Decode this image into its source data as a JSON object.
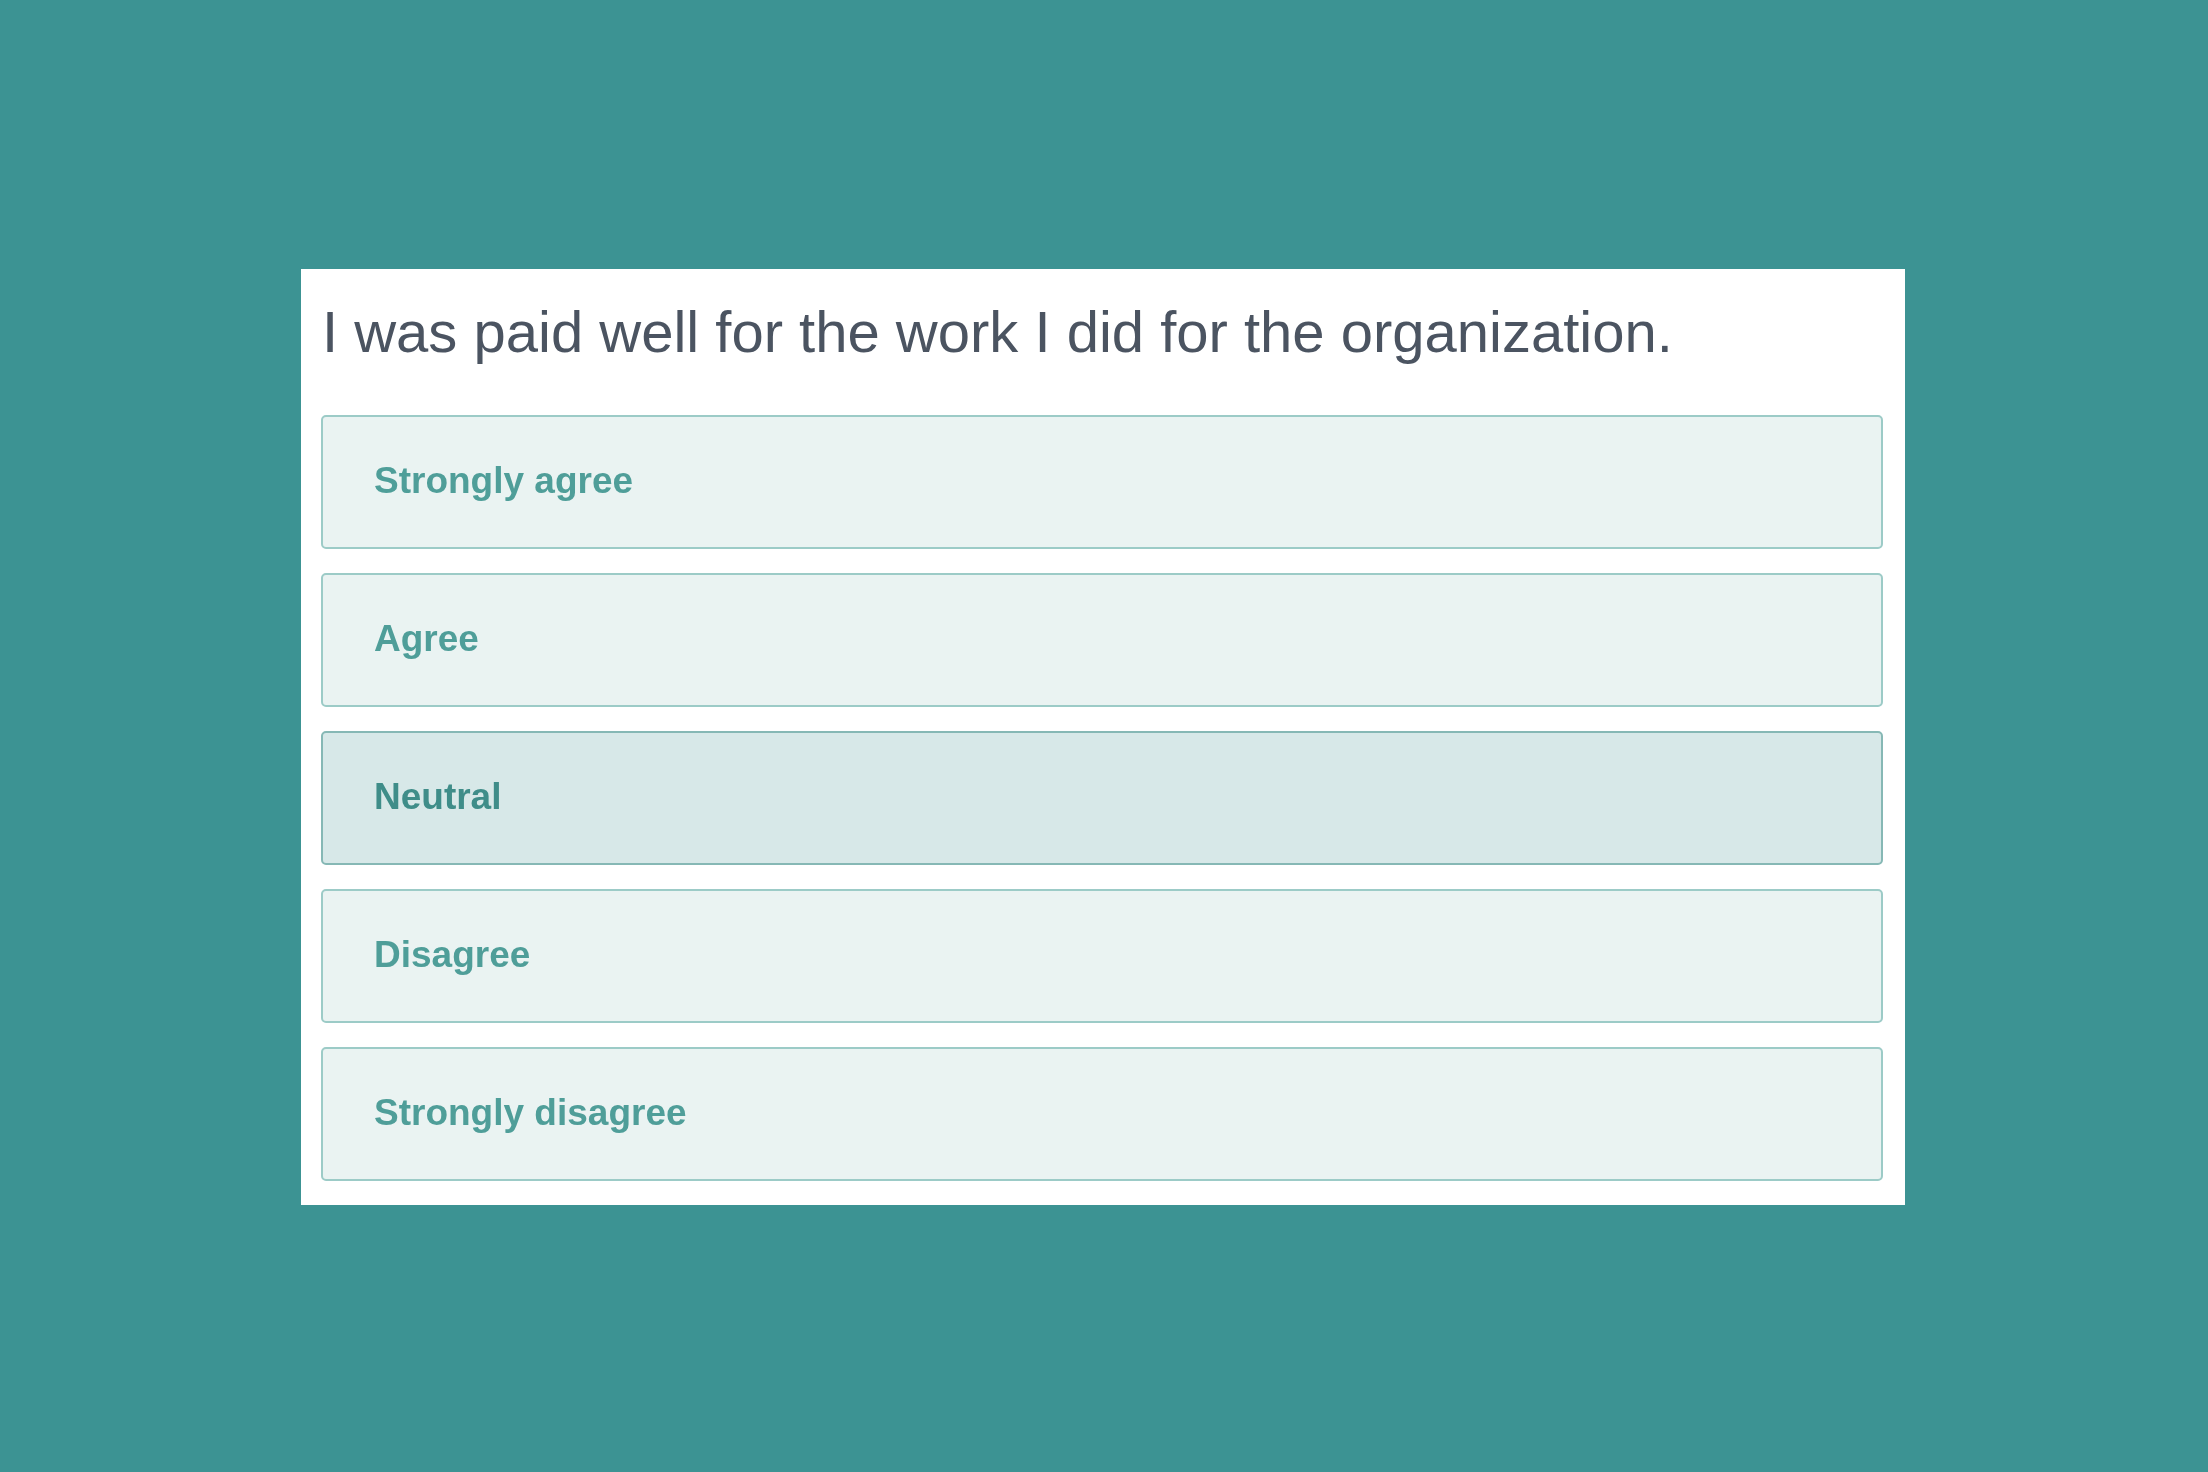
{
  "survey": {
    "question": "I was paid well for the work I did for the organization.",
    "options": [
      {
        "label": "Strongly agree",
        "selected": false
      },
      {
        "label": "Agree",
        "selected": false
      },
      {
        "label": "Neutral",
        "selected": true
      },
      {
        "label": "Disagree",
        "selected": false
      },
      {
        "label": "Strongly disagree",
        "selected": false
      }
    ]
  }
}
